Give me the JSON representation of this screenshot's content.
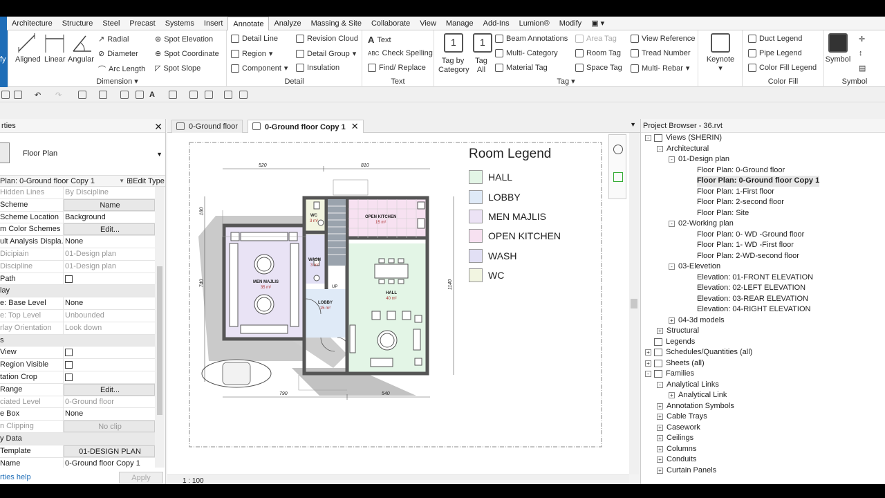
{
  "menu": {
    "tabs": [
      "Architecture",
      "Structure",
      "Steel",
      "Precast",
      "Systems",
      "Insert",
      "Annotate",
      "Analyze",
      "Massing & Site",
      "Collaborate",
      "View",
      "Manage",
      "Add-Ins",
      "Lumion®",
      "Modify"
    ],
    "active": "Annotate"
  },
  "ribbon": {
    "modify_label": "fy",
    "dimension": {
      "title": "Dimension",
      "aligned": "Aligned",
      "linear": "Linear",
      "angular": "Angular",
      "radial": "Radial",
      "diameter": "Diameter",
      "arc_length": "Arc Length",
      "spot_elevation": "Spot Elevation",
      "spot_coordinate": "Spot Coordinate",
      "spot_slope": "Spot Slope"
    },
    "detail": {
      "title": "Detail",
      "detail_line": "Detail Line",
      "region": "Region",
      "component": "Component",
      "revision_cloud": "Revision Cloud",
      "detail_group": "Detail Group",
      "insulation": "Insulation"
    },
    "text": {
      "title": "Text",
      "text": "Text",
      "check_spelling": "Check Spelling",
      "find_replace": "Find/ Replace"
    },
    "tag": {
      "title": "Tag",
      "tag_by_category": "Tag by Category",
      "tag_all": "Tag All",
      "beam_annotations": "Beam Annotations",
      "multi_category": "Multi- Category",
      "material_tag": "Material Tag",
      "area_tag": "Area Tag",
      "room_tag": "Room Tag",
      "space_tag": "Space Tag",
      "view_reference": "View Reference",
      "tread_number": "Tread Number",
      "multi_rebar": "Multi- Rebar"
    },
    "keynote": "Keynote",
    "color_fill": {
      "title": "Color Fill",
      "duct_legend": "Duct Legend",
      "pipe_legend": "Pipe Legend",
      "color_fill_legend": "Color Fill Legend"
    },
    "symbol": {
      "title": "Symbol",
      "symbol": "Symbol"
    }
  },
  "properties": {
    "title": "rties",
    "type_name": "Floor Plan",
    "instance": "Plan: 0-Ground floor Copy 1",
    "edit_type": "Edit Type",
    "rows": [
      {
        "k": "Hidden Lines",
        "v": "By Discipline",
        "dim": true
      },
      {
        "k": "Scheme",
        "v": "Name",
        "btn": true
      },
      {
        "k": "Scheme Location",
        "v": "Background"
      },
      {
        "k": "m Color Schemes",
        "v": "Edit...",
        "btn": true
      },
      {
        "k": "ult Analysis Displa...",
        "v": "None"
      },
      {
        "k": "Dicipiain",
        "v": "01-Design plan",
        "dim": true
      },
      {
        "k": "Discipline",
        "v": "01-Design plan",
        "dim": true
      },
      {
        "k": "Path",
        "v": "",
        "chk": true
      },
      {
        "k": "lay",
        "group": true
      },
      {
        "k": "e: Base Level",
        "v": "None"
      },
      {
        "k": "e: Top Level",
        "v": "Unbounded",
        "dim": true
      },
      {
        "k": "rlay Orientation",
        "v": "Look down",
        "dim": true
      },
      {
        "k": "s",
        "group": true
      },
      {
        "k": "View",
        "v": "",
        "chk": true
      },
      {
        "k": "Region Visible",
        "v": "",
        "chk": true
      },
      {
        "k": "tation Crop",
        "v": "",
        "chk": true
      },
      {
        "k": "Range",
        "v": "Edit...",
        "btn": true
      },
      {
        "k": "ciated Level",
        "v": "0-Ground floor",
        "dim": true
      },
      {
        "k": "e Box",
        "v": "None"
      },
      {
        "k": "n Clipping",
        "v": "No clip",
        "btn": true,
        "dim": true
      },
      {
        "k": "y Data",
        "group": true
      },
      {
        "k": "Template",
        "v": "01-DESIGN PLAN",
        "btn": true
      },
      {
        "k": "Name",
        "v": "0-Ground floor Copy 1"
      }
    ],
    "help_link": "rties help",
    "apply": "Apply"
  },
  "view_tabs": [
    {
      "label": "0-Ground floor",
      "active": false
    },
    {
      "label": "0-Ground floor Copy 1",
      "active": true
    }
  ],
  "plan": {
    "dims": {
      "top_left": "520",
      "top_right": "810",
      "left": "180",
      "left2": "740",
      "right": "1140",
      "bottom_left": "790",
      "bottom_right": "540"
    },
    "rooms": [
      {
        "name": "WC",
        "area": "3 m²"
      },
      {
        "name": "OPEN KITCHEN",
        "area": "15 m²"
      },
      {
        "name": "MEN MAJLIS",
        "area": "35 m²"
      },
      {
        "name": "WASH",
        "area": "3 m²"
      },
      {
        "name": "HALL",
        "area": "40 m²"
      },
      {
        "name": "LOBBY",
        "area": "15 m²"
      }
    ],
    "up_label": "UP"
  },
  "legend": {
    "title": "Room Legend",
    "items": [
      {
        "label": "HALL",
        "color": "#e3f5e6"
      },
      {
        "label": "LOBBY",
        "color": "#dfeaf7"
      },
      {
        "label": "MEN MAJLIS",
        "color": "#ece3f5"
      },
      {
        "label": "OPEN KITCHEN",
        "color": "#f7e1f1"
      },
      {
        "label": "WASH",
        "color": "#e2e0f5"
      },
      {
        "label": "WC",
        "color": "#f2f5e1"
      }
    ]
  },
  "scale": "1 : 100",
  "browser": {
    "title": "Project Browser - 36.rvt",
    "nodes": [
      {
        "label": "Views (SHERIN)",
        "level": 0,
        "exp": "-",
        "icon": true
      },
      {
        "label": "Architectural",
        "level": 1,
        "exp": "-"
      },
      {
        "label": "01-Design plan",
        "level": 2,
        "exp": "-"
      },
      {
        "label": "Floor Plan: 0-Ground floor",
        "level": 3
      },
      {
        "label": "Floor Plan: 0-Ground floor Copy 1",
        "level": 3,
        "bold": true
      },
      {
        "label": "Floor Plan: 1-First floor",
        "level": 3
      },
      {
        "label": "Floor Plan: 2-second floor",
        "level": 3
      },
      {
        "label": "Floor Plan: Site",
        "level": 3
      },
      {
        "label": "02-Working plan",
        "level": 2,
        "exp": "-"
      },
      {
        "label": "Floor Plan: 0- WD -Ground floor",
        "level": 3
      },
      {
        "label": "Floor Plan: 1- WD -First floor",
        "level": 3
      },
      {
        "label": "Floor Plan: 2-WD-second floor",
        "level": 3
      },
      {
        "label": "03-Elevetion",
        "level": 2,
        "exp": "-"
      },
      {
        "label": "Elevation: 01-FRONT ELEVATION",
        "level": 3
      },
      {
        "label": "Elevation: 02-LEFT ELEVATION",
        "level": 3
      },
      {
        "label": "Elevation: 03-REAR ELEVATION",
        "level": 3
      },
      {
        "label": "Elevation: 04-RIGHT ELEVATION",
        "level": 3
      },
      {
        "label": "04-3d models",
        "level": 2,
        "exp": "+"
      },
      {
        "label": "Structural",
        "level": 1,
        "exp": "+"
      },
      {
        "label": "Legends",
        "level": 0,
        "icon": true
      },
      {
        "label": "Schedules/Quantities (all)",
        "level": 0,
        "exp": "+",
        "icon": true
      },
      {
        "label": "Sheets (all)",
        "level": 0,
        "exp": "+",
        "icon": true
      },
      {
        "label": "Families",
        "level": 0,
        "exp": "-",
        "icon": true
      },
      {
        "label": "Analytical Links",
        "level": 1,
        "exp": "-"
      },
      {
        "label": "Analytical Link",
        "level": 2,
        "exp": "+"
      },
      {
        "label": "Annotation Symbols",
        "level": 1,
        "exp": "+"
      },
      {
        "label": "Cable Trays",
        "level": 1,
        "exp": "+"
      },
      {
        "label": "Casework",
        "level": 1,
        "exp": "+"
      },
      {
        "label": "Ceilings",
        "level": 1,
        "exp": "+"
      },
      {
        "label": "Columns",
        "level": 1,
        "exp": "+"
      },
      {
        "label": "Conduits",
        "level": 1,
        "exp": "+"
      },
      {
        "label": "Curtain Panels",
        "level": 1,
        "exp": "+"
      }
    ]
  }
}
